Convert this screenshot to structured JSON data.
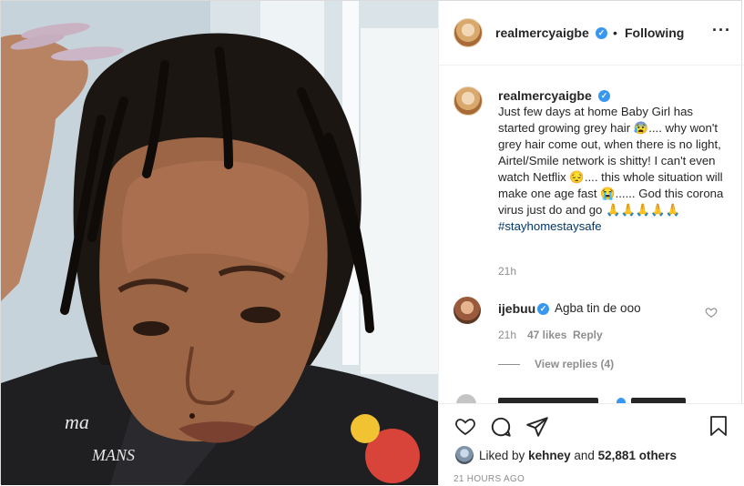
{
  "post": {
    "author": "realmercyaigbe",
    "separator": "•",
    "follow_label": "Following",
    "more_icon": "ellipsis-icon",
    "caption_prefix": "Just few days at home Baby Girl has started growing grey hair 😰.... why won't grey hair come out, when there is no light, Airtel/Smile network is shitty! I can't even watch Netflix 😔.... this whole situation will make one age fast 😭...... God this corona virus just do and go 🙏🙏🙏🙏🙏",
    "hashtag": "#stayhomestaysafe",
    "caption_time": "21h"
  },
  "comments": [
    {
      "user": "ijebuu",
      "text": "Agba tin de ooo",
      "time": "21h",
      "likes": "47 likes",
      "reply_label": "Reply",
      "view_replies": "View replies (4)"
    }
  ],
  "footer": {
    "liked_by_prefix": "Liked by",
    "liked_by_user": "kehney",
    "and_label": "and",
    "others_count": "52,881 others",
    "timestamp": "21 HOURS AGO"
  },
  "colors": {
    "verified": "#3897f0",
    "secondary_text": "#8e8e8e",
    "primary_text": "#262626",
    "hashtag": "#00376b"
  }
}
